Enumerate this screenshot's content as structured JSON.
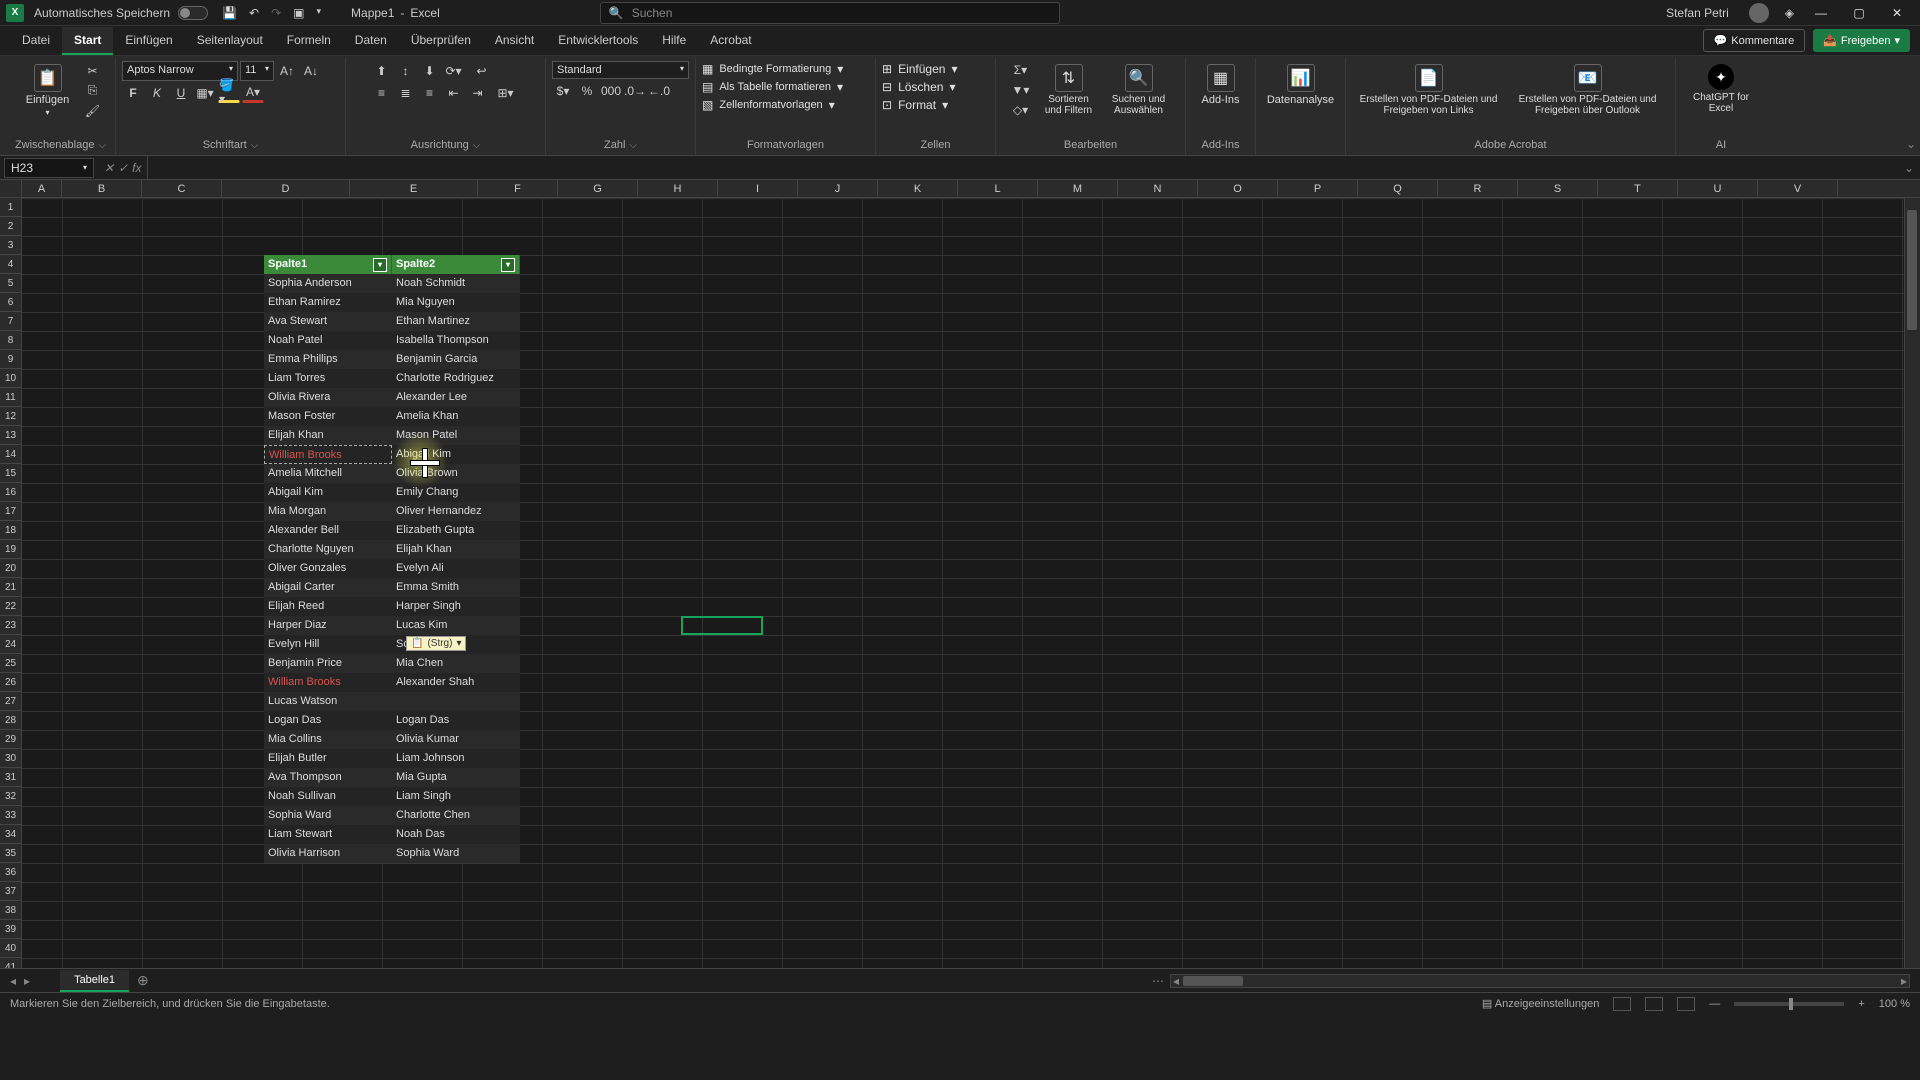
{
  "title_bar": {
    "autosave_label": "Automatisches Speichern",
    "doc_name": "Mappe1",
    "app_name": "Excel",
    "search_placeholder": "Suchen",
    "user_name": "Stefan Petri"
  },
  "menu_tabs": [
    "Datei",
    "Start",
    "Einfügen",
    "Seitenlayout",
    "Formeln",
    "Daten",
    "Überprüfen",
    "Ansicht",
    "Entwicklertools",
    "Hilfe",
    "Acrobat"
  ],
  "active_tab_index": 1,
  "menu_right": {
    "comments": "Kommentare",
    "share": "Freigeben"
  },
  "ribbon": {
    "clipboard": {
      "paste": "Einfügen",
      "label": "Zwischenablage"
    },
    "font": {
      "name": "Aptos Narrow",
      "size": "11",
      "label": "Schriftart"
    },
    "alignment": {
      "label": "Ausrichtung"
    },
    "number": {
      "format": "Standard",
      "label": "Zahl"
    },
    "styles": {
      "conditional": "Bedingte Formatierung",
      "table_fmt": "Als Tabelle formatieren",
      "cell_fmt": "Zellenformatvorlagen",
      "label": "Formatvorlagen"
    },
    "cells": {
      "insert": "Einfügen",
      "delete": "Löschen",
      "format": "Format",
      "label": "Zellen"
    },
    "editing": {
      "sort": "Sortieren und Filtern",
      "find": "Suchen und Auswählen",
      "label": "Bearbeiten"
    },
    "addins": {
      "addins": "Add-Ins",
      "label": "Add-Ins"
    },
    "data_analysis": "Datenanalyse",
    "acrobat": {
      "pdf_links": "Erstellen von PDF-Dateien und Freigeben von Links",
      "pdf_outlook": "Erstellen von PDF-Dateien und Freigeben über Outlook",
      "label": "Adobe Acrobat"
    },
    "ai": {
      "chatgpt": "ChatGPT for Excel",
      "label": "AI"
    }
  },
  "name_box": "H23",
  "columns": [
    "A",
    "B",
    "C",
    "D",
    "E",
    "F",
    "G",
    "H",
    "I",
    "J",
    "K",
    "L",
    "M",
    "N",
    "O",
    "P",
    "Q",
    "R",
    "S",
    "T",
    "U",
    "V"
  ],
  "row_count": 41,
  "table": {
    "headers": [
      "Spalte1",
      "Spalte2"
    ],
    "rows": [
      [
        "Sophia Anderson",
        "Noah Schmidt"
      ],
      [
        "Ethan Ramirez",
        "Mia Nguyen"
      ],
      [
        "Ava Stewart",
        "Ethan Martinez"
      ],
      [
        "Noah Patel",
        "Isabella Thompson"
      ],
      [
        "Emma Phillips",
        "Benjamin Garcia"
      ],
      [
        "Liam Torres",
        "Charlotte Rodriguez"
      ],
      [
        "Olivia Rivera",
        "Alexander Lee"
      ],
      [
        "Mason Foster",
        "Amelia Khan"
      ],
      [
        "Elijah Khan",
        "Mason Patel"
      ],
      [
        "William Brooks",
        "Abigail Kim"
      ],
      [
        "Amelia Mitchell",
        "Olivia Brown"
      ],
      [
        "Abigail Kim",
        "Emily Chang"
      ],
      [
        "Mia Morgan",
        "Oliver Hernandez"
      ],
      [
        "Alexander Bell",
        "Elizabeth Gupta"
      ],
      [
        "Charlotte Nguyen",
        "Elijah Khan"
      ],
      [
        "Oliver Gonzales",
        "Evelyn Ali"
      ],
      [
        "Abigail Carter",
        "Emma Smith"
      ],
      [
        "Elijah Reed",
        "Harper Singh"
      ],
      [
        "Harper Diaz",
        "Lucas Kim"
      ],
      [
        "Evelyn Hill",
        "Sophia Patel"
      ],
      [
        "Benjamin Price",
        "Mia Chen"
      ],
      [
        "William Brooks",
        "Alexander Shah"
      ],
      [
        "Lucas Watson",
        ""
      ],
      [
        "Logan Das",
        "Logan Das"
      ],
      [
        "Mia Collins",
        "Olivia Kumar"
      ],
      [
        "Elijah Butler",
        "Liam Johnson"
      ],
      [
        "Ava Thompson",
        "Mia Gupta"
      ],
      [
        "Noah Sullivan",
        "Liam Singh"
      ],
      [
        "Sophia Ward",
        "Charlotte Chen"
      ],
      [
        "Liam Stewart",
        "Noah Das"
      ],
      [
        "Olivia Harrison",
        "Sophia Ward"
      ]
    ],
    "highlighted_red_rows_col0": [
      9,
      21
    ],
    "marching_ants_row": 9
  },
  "paste_indicator": "(Strg)",
  "sheet_tab": "Tabelle1",
  "status_text": "Markieren Sie den Zielbereich, und drücken Sie die Eingabetaste.",
  "status_right": {
    "display_settings": "Anzeigeeinstellungen",
    "zoom": "100 %"
  },
  "selected_cell": {
    "col": "H",
    "row": 23
  }
}
